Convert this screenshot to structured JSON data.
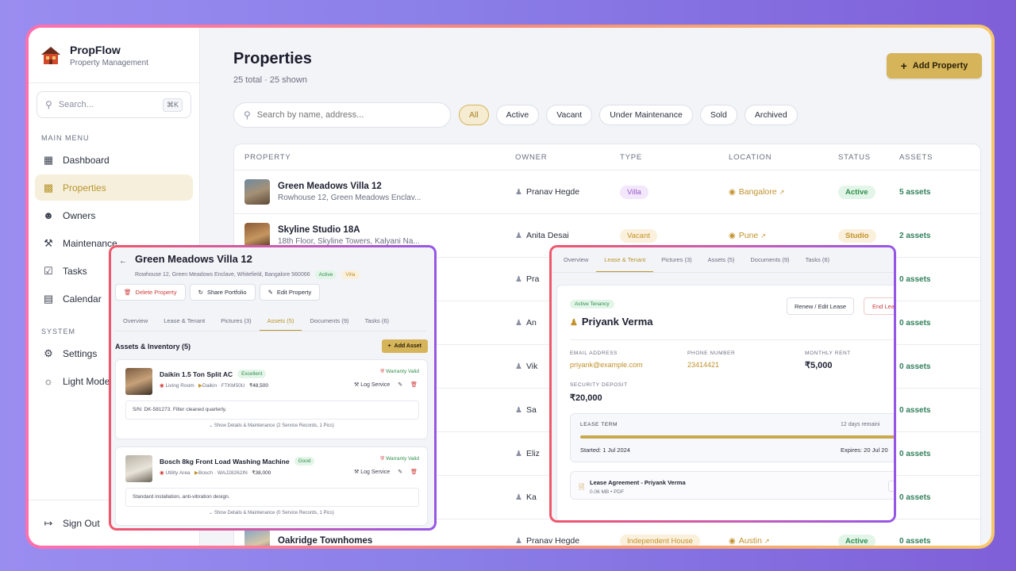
{
  "app": {
    "name": "PropFlow",
    "subtitle": "Property Management"
  },
  "sidebar": {
    "search_placeholder": "Search...",
    "search_shortcut": "⌘K",
    "main_menu_label": "MAIN MENU",
    "main_items": [
      {
        "label": "Dashboard",
        "icon": "grid-icon"
      },
      {
        "label": "Properties",
        "icon": "building-icon",
        "active": true
      },
      {
        "label": "Owners",
        "icon": "users-icon"
      },
      {
        "label": "Maintenance",
        "icon": "wrench-icon"
      },
      {
        "label": "Tasks",
        "icon": "check-square-icon"
      },
      {
        "label": "Calendar",
        "icon": "calendar-icon"
      }
    ],
    "system_label": "SYSTEM",
    "system_items": [
      {
        "label": "Settings",
        "icon": "gear-icon"
      },
      {
        "label": "Light Mode",
        "icon": "sun-icon"
      }
    ],
    "sign_out": "Sign Out"
  },
  "page": {
    "title": "Properties",
    "subtitle": "25 total · 25 shown",
    "add_button": "Add Property",
    "search_placeholder": "Search by name, address...",
    "filters": [
      "All",
      "Active",
      "Vacant",
      "Under Maintenance",
      "Sold",
      "Archived"
    ],
    "active_filter": "All"
  },
  "table": {
    "headers": [
      "PROPERTY",
      "OWNER",
      "TYPE",
      "LOCATION",
      "STATUS",
      "ASSETS"
    ],
    "rows": [
      {
        "name": "Green Meadows Villa 12",
        "address": "Rowhouse 12, Green Meadows Enclav...",
        "owner": "Pranav Hegde",
        "type": "Villa",
        "location": "Bangalore",
        "status": "Active",
        "assets": "5 assets"
      },
      {
        "name": "Skyline Studio 18A",
        "address": "18th Floor, Skyline Towers, Kalyani Na...",
        "owner": "Anita Desai",
        "type": "Vacant",
        "location": "Pune",
        "status": "Studio",
        "assets": "2 assets"
      },
      {
        "owner": "Pra",
        "assets": "0 assets"
      },
      {
        "owner": "An",
        "assets": "0 assets"
      },
      {
        "owner": "Vik",
        "assets": "0 assets"
      },
      {
        "owner": "Sa",
        "assets": "0 assets"
      },
      {
        "owner": "Eliz",
        "assets": "0 assets"
      },
      {
        "owner": "Ka",
        "assets": "0 assets"
      },
      {
        "name": "Oakridge Townhomes",
        "owner": "Pranav Hegde",
        "type": "Independent House",
        "location": "Austin",
        "status": "Active",
        "assets": "0 assets"
      }
    ]
  },
  "detail_left": {
    "title": "Green Meadows Villa 12",
    "address": "Rowhouse 12, Green Meadows Enclave, Whitefield, Bangalore 560066",
    "status": "Active",
    "type": "Villa",
    "buttons": {
      "delete": "Delete Property",
      "share": "Share Portfolio",
      "edit": "Edit Property"
    },
    "tabs": [
      "Overview",
      "Lease & Tenant",
      "Pictures (3)",
      "Assets (5)",
      "Documents (9)",
      "Tasks (6)"
    ],
    "active_tab": "Assets (5)",
    "section_title": "Assets & Inventory (5)",
    "add_asset": "Add Asset",
    "assets": [
      {
        "name": "Daikin 1.5 Ton Split AC",
        "condition": "Excellent",
        "room": "Living Room",
        "brand": "Daikin · FTKM50U",
        "price": "₹48,500",
        "warranty": "Warranty Valid",
        "log": "Log Service",
        "note": "S/N: DK-581273. Filter cleaned quarterly.",
        "more": "Show Details & Maintenance (2 Service Records, 1 Pics)"
      },
      {
        "name": "Bosch 8kg Front Load Washing Machine",
        "condition": "Good",
        "room": "Utility Area",
        "brand": "Bosch · WAJ28262IN",
        "price": "₹38,000",
        "warranty": "Warranty Valid",
        "log": "Log Service",
        "note": "Standard installation, anti-vibration design.",
        "more": "Show Details & Maintenance (0 Service Records, 1 Pics)"
      }
    ]
  },
  "detail_right": {
    "tabs": [
      "Overview",
      "Lease & Tenant",
      "Pictures (3)",
      "Assets (5)",
      "Documents (9)",
      "Tasks (6)"
    ],
    "active_tab": "Lease & Tenant",
    "tenancy_badge": "Active Tenancy",
    "tenant_name": "Priyank Verma",
    "renew_button": "Renew / Edit Lease",
    "end_button": "End Lea",
    "email_label": "EMAIL ADDRESS",
    "email": "priyank@example.com",
    "phone_label": "PHONE NUMBER",
    "phone": "23414421",
    "rent_label": "MONTHLY RENT",
    "rent": "₹5,000",
    "deposit_label": "SECURITY DEPOSIT",
    "deposit": "₹20,000",
    "lease_term_label": "LEASE TERM",
    "remaining": "12 days remaini",
    "lease_progress": 0.97,
    "started": "Started: 1 Jul 2024",
    "expires": "Expires: 20 Jul 20",
    "doc_name": "Lease Agreement - Priyank Verma",
    "doc_meta": "0.06 MB • PDF"
  },
  "colors": {
    "accent": "#d6b45a",
    "active_green": "#2f8f4d",
    "danger": "#d03b3b"
  }
}
